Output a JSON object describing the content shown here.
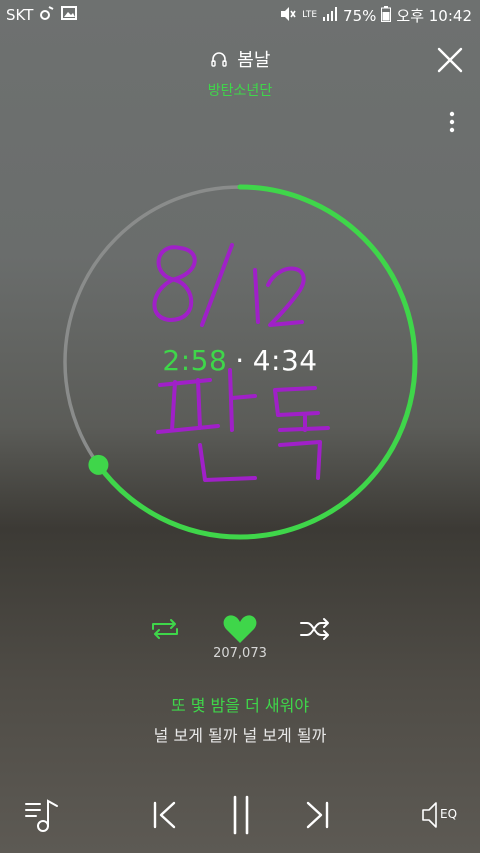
{
  "status_bar": {
    "carrier": "SKT",
    "network": "LTE",
    "battery": "75%",
    "time": "오후 10:42",
    "icons": [
      "music-note-icon",
      "image-icon",
      "mute-icon",
      "lte-icon",
      "signal-icon",
      "battery-icon"
    ]
  },
  "header": {
    "song_title": "봄날",
    "artist": "방탄소년단",
    "icons": [
      "headphone-icon",
      "close-icon",
      "more-vert-icon"
    ]
  },
  "player": {
    "current_time": "2:58",
    "separator": "·",
    "total_time": "4:34",
    "progress_fraction": 0.65,
    "accent_color": "#3fd64a",
    "handwritten_note": "8/12 편독"
  },
  "actions": {
    "like_count": "207,073",
    "icons": [
      "repeat-icon",
      "heart-icon",
      "shuffle-icon"
    ]
  },
  "lyrics": {
    "current_line": "또 몇 밤을 더 새워야",
    "next_line": "널 보게 될까 널 보게 될까"
  },
  "bottom_controls": {
    "eq_label": "EQ",
    "icons": [
      "playlist-icon",
      "previous-icon",
      "pause-icon",
      "next-icon",
      "equalizer-icon"
    ]
  }
}
